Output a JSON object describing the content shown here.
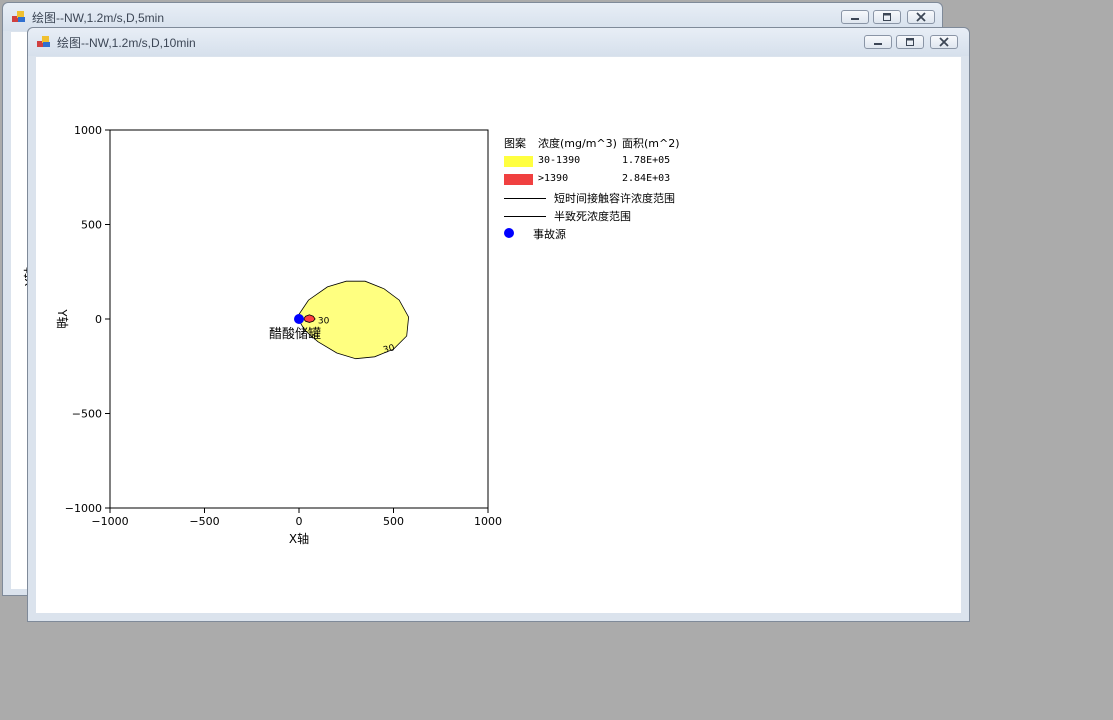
{
  "windows": {
    "back": {
      "title": "绘图--NW,1.2m/s,D,5min",
      "partial_ylabel": "Y轴"
    },
    "front": {
      "title": "绘图--NW,1.2m/s,D,10min"
    }
  },
  "chart_data": {
    "type": "area",
    "xlabel": "X轴",
    "ylabel": "Y轴",
    "xlim": [
      -1000,
      1000
    ],
    "ylim": [
      -1000,
      1000
    ],
    "x_ticks": [
      "−1000",
      "−500",
      "0",
      "500",
      "1000"
    ],
    "y_ticks": [
      "1000",
      "500",
      "0",
      "−500",
      "−1000"
    ],
    "grid": false,
    "legend_placement": "right",
    "series": [
      {
        "name": "30-1390",
        "color": "#ffff80",
        "contour_label": "30",
        "outline": [
          [
            -10,
            10
          ],
          [
            50,
            100
          ],
          [
            150,
            170
          ],
          [
            250,
            200
          ],
          [
            350,
            200
          ],
          [
            450,
            160
          ],
          [
            530,
            100
          ],
          [
            580,
            10
          ],
          [
            570,
            -90
          ],
          [
            500,
            -160
          ],
          [
            400,
            -200
          ],
          [
            300,
            -210
          ],
          [
            200,
            -180
          ],
          [
            100,
            -120
          ],
          [
            30,
            -60
          ],
          [
            -10,
            10
          ]
        ]
      },
      {
        "name": ">1390",
        "color": "#ff4040",
        "contour_label": "30",
        "outline": [
          [
            25,
            0
          ],
          [
            35,
            15
          ],
          [
            55,
            22
          ],
          [
            75,
            15
          ],
          [
            85,
            0
          ],
          [
            75,
            -12
          ],
          [
            55,
            -18
          ],
          [
            35,
            -12
          ],
          [
            25,
            0
          ]
        ]
      }
    ],
    "source": {
      "x": 0,
      "y": 0,
      "label": "醋酸储罐",
      "color": "#0000ff"
    },
    "legend": {
      "header": [
        "图案",
        "浓度(mg/m^3)",
        "面积(m^2)"
      ],
      "rows": [
        {
          "range": "30-1390",
          "area": "1.78E+05",
          "color": "#ffff40"
        },
        {
          "range": ">1390",
          "area": "2.84E+03",
          "color": "#f04040"
        }
      ],
      "lines": [
        "短时间接触容许浓度范围",
        "半致死浓度范围"
      ],
      "source_label": "事故源"
    }
  }
}
